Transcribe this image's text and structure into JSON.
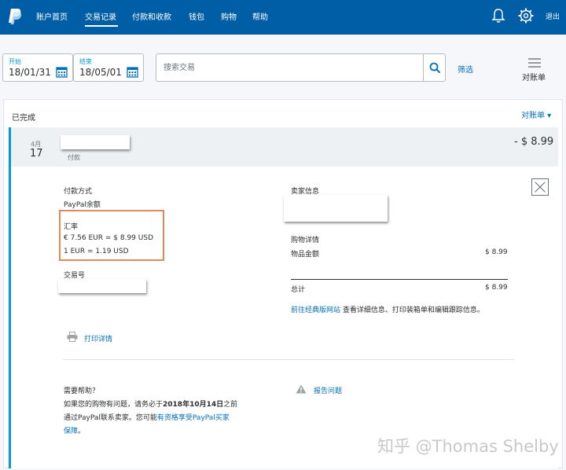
{
  "nav": {
    "items": [
      "账户首页",
      "交易记录",
      "付款和收款",
      "钱包",
      "购物",
      "帮助"
    ],
    "logout": "退出",
    "colors": {
      "bar": "#005ea6",
      "link": "#0070ba",
      "accent": "#009cde",
      "highlight": "#e08a5a"
    }
  },
  "filter": {
    "start_label": "开始",
    "start_value": "18/01/31",
    "end_label": "结束",
    "end_value": "18/05/01",
    "search_placeholder": "搜索交易",
    "filter_link": "筛选",
    "statement_label": "对账单"
  },
  "list": {
    "status_title": "已完成",
    "statement_dropdown": "对账单 ▾",
    "transaction": {
      "month": "4月",
      "day": "17",
      "type": "付款",
      "amount": "- $ 8.99"
    }
  },
  "details": {
    "payment_method_label": "付款方式",
    "payment_method_value": "PayPal余额",
    "rate_label": "汇率",
    "rate_line1": "€ 7.56 EUR = $ 8.99 USD",
    "rate_line2": "1 EUR = 1.19 USD",
    "txn_id_label": "交易号",
    "seller_label": "卖家信息",
    "purchase_label": "购物详情",
    "item_amount_label": "物品金额",
    "item_amount_value": "$ 8.99",
    "total_label": "总计",
    "total_value": "$ 8.99",
    "classic_link": "前往经典版网站",
    "classic_text": " 查看详细信息、打印装箱单和编辑跟踪信息。",
    "print_link": "打印详情",
    "help_title": "需要帮助？",
    "help_line1_pre": "如果您的购物有问题，请务必于",
    "help_line1_bold": "2018年10月14日",
    "help_line1_post": "之前",
    "help_line2_pre": "通过PayPal联系卖家。您可能",
    "help_line2_link": "有资格享受PayPal买家",
    "help_line3_link": "保障",
    "help_line3_post": "。",
    "report_link": "报告问题"
  },
  "watermark": "知乎 @Thomas Shelby",
  "icons": [
    "paypal-logo-icon",
    "bell-icon",
    "gear-icon",
    "calendar-icon",
    "search-icon",
    "statement-icon",
    "close-icon",
    "printer-icon",
    "warning-icon"
  ]
}
